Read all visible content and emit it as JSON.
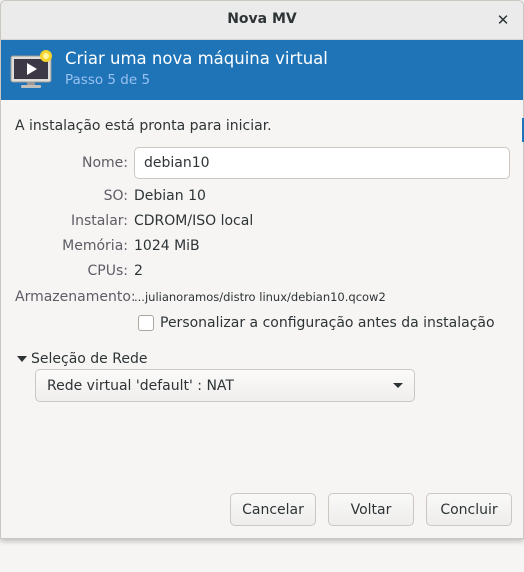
{
  "window": {
    "title": "Nova MV",
    "close_icon": "✕"
  },
  "header": {
    "title": "Criar uma nova máquina virtual",
    "subtitle": "Passo 5 de 5",
    "icon": "new-vm-monitor-icon",
    "accent_color": "#1f73b7"
  },
  "summary": {
    "ready_text": "A instalação está pronta para iniciar.",
    "name_label": "Nome:",
    "name_value": "debian10",
    "os_label": "SO:",
    "os_value": "Debian 10",
    "install_label": "Instalar:",
    "install_value": "CDROM/ISO local",
    "memory_label": "Memória:",
    "memory_value": "1024 MiB",
    "cpus_label": "CPUs:",
    "cpus_value": "2",
    "storage_label": "Armazenamento:",
    "storage_value": "...julianoramos/distro linux/debian10.qcow2",
    "customize_label": "Personalizar a configuração antes da instalação",
    "customize_checked": false
  },
  "network": {
    "expander_label": "Seleção de Rede",
    "selected": "Rede virtual 'default' : NAT"
  },
  "buttons": {
    "cancel": "Cancelar",
    "back": "Voltar",
    "finish": "Concluir"
  }
}
